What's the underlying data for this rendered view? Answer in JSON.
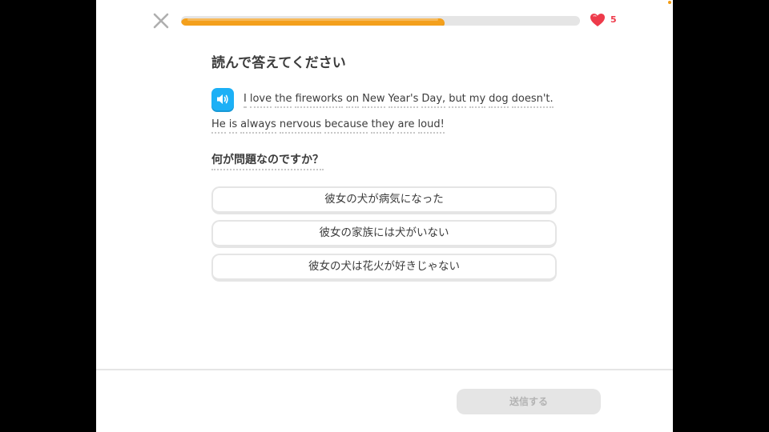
{
  "header": {
    "close_icon": "close-icon",
    "progress": {
      "fraction": 0.66,
      "color": "#f4a01c",
      "track_color": "#e5e5e5"
    },
    "hearts": {
      "icon": "heart-icon",
      "count": "5",
      "color": "#ee3a4a"
    }
  },
  "exercise": {
    "title": "読んで答えてください",
    "speaker_icon": "speaker-icon",
    "passage": {
      "line1": [
        "I",
        "love",
        "the",
        "fireworks",
        "on",
        "New",
        "Year's",
        "Day,",
        "but",
        "my",
        "dog",
        "doesn't."
      ],
      "line2": [
        "He",
        "is",
        "always",
        "nervous",
        "because",
        "they",
        "are",
        "loud!"
      ]
    },
    "question": "何が問題なのですか？",
    "choices": [
      "彼女の犬が病気になった",
      "彼女の家族には犬がいない",
      "彼女の犬は花火が好きじゃない"
    ]
  },
  "footer": {
    "submit_label": "送信する",
    "submit_enabled": false
  },
  "colors": {
    "accent_blue": "#1cb0f6",
    "text": "#3c3c3c",
    "border": "#e5e5e5"
  }
}
